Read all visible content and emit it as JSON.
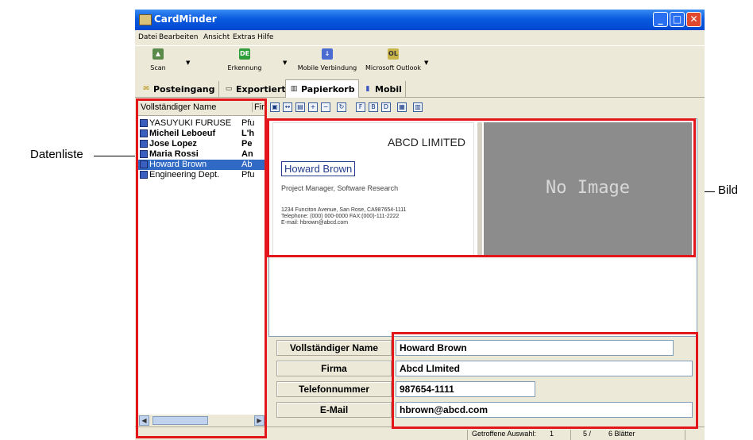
{
  "callouts": {
    "datenliste": "Datenliste",
    "bild": "Bild"
  },
  "window": {
    "title": "CardMinder",
    "min": "_",
    "max": "□",
    "close": "✕"
  },
  "menu": [
    "Datei",
    "Bearbeiten",
    "Ansicht",
    "Extras",
    "Hilfe"
  ],
  "toolbar": {
    "scan": "Scan",
    "erkennung": "Erkennung",
    "mobile": "Mobile Verbindung",
    "outlook": "Microsoft Outlook"
  },
  "tabs": [
    "Posteingang",
    "Exportiert",
    "Papierkorb",
    "Mobil"
  ],
  "list": {
    "col_name": "Vollständiger Name",
    "col_firm": "Fir",
    "rows": [
      {
        "name": "YASUYUKI FURUSE",
        "company": "Pfu",
        "bold": false,
        "selected": false
      },
      {
        "name": "Micheil Leboeuf",
        "company": "L'h",
        "bold": true,
        "selected": false
      },
      {
        "name": "Jose Lopez",
        "company": "Pe",
        "bold": true,
        "selected": false
      },
      {
        "name": "Maria Rossi",
        "company": "An",
        "bold": true,
        "selected": false
      },
      {
        "name": "Howard Brown",
        "company": "Ab",
        "bold": false,
        "selected": true
      },
      {
        "name": "Engineering Dept.",
        "company": "Pfu",
        "bold": false,
        "selected": false
      }
    ]
  },
  "card": {
    "company": "ABCD LIMITED",
    "name": "Howard Brown",
    "title": "Project Manager, Software Research",
    "address": "1234 Funciton Avenue, San Rose, CA987654-1111",
    "phone": "Telephone: (000) 000-0000  FAX:(000)-111-2222",
    "email": "E-mail: hbrown@abcd.com"
  },
  "no_image": "No Image",
  "fields": [
    {
      "label": "Vollständiger Name",
      "value": "Howard Brown"
    },
    {
      "label": "Firma",
      "value": "Abcd LImited"
    },
    {
      "label": "Telefonnummer",
      "value": "987654-1111"
    },
    {
      "label": "E-Mail",
      "value": "hbrown@abcd.com"
    }
  ],
  "status": {
    "selection_label": "Getroffene Auswahl:",
    "selection_count": "1",
    "page": "5 /",
    "sheets": "6 Blätter"
  },
  "colors": {
    "highlight_red": "#e3161b",
    "selection_blue": "#316ac5",
    "title_blue": "#0a5adf"
  }
}
